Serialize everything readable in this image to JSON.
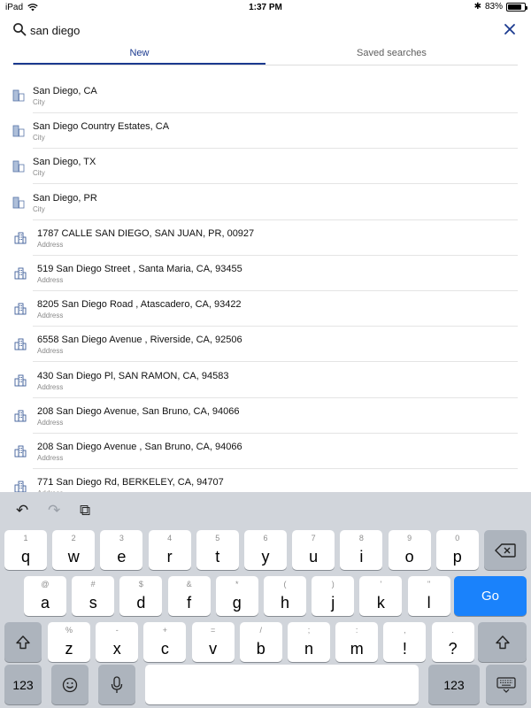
{
  "status_bar": {
    "device": "iPad",
    "time": "1:37 PM",
    "battery": "83%",
    "battery_level": 0.83,
    "bluetooth_glyph": "✱"
  },
  "search": {
    "query": "san diego",
    "icon": "search-icon",
    "close_icon": "close-icon"
  },
  "tabs": [
    {
      "label": "New",
      "active": true
    },
    {
      "label": "Saved searches",
      "active": false
    }
  ],
  "colors": {
    "accent": "#1b3a8f",
    "go_key": "#1a82fb",
    "keyboard_bg": "#d1d5db"
  },
  "results": [
    {
      "title": "San Diego, CA",
      "type": "City",
      "icon": "city-icon"
    },
    {
      "title": "San Diego Country Estates, CA",
      "type": "City",
      "icon": "city-icon"
    },
    {
      "title": "San Diego, TX",
      "type": "City",
      "icon": "city-icon"
    },
    {
      "title": "San Diego, PR",
      "type": "City",
      "icon": "city-icon"
    },
    {
      "title": "1787 CALLE SAN DIEGO, SAN JUAN, PR, 00927",
      "type": "Address",
      "icon": "building-icon"
    },
    {
      "title": "519 San Diego Street , Santa Maria, CA, 93455",
      "type": "Address",
      "icon": "building-icon"
    },
    {
      "title": "8205 San Diego Road , Atascadero, CA, 93422",
      "type": "Address",
      "icon": "building-icon"
    },
    {
      "title": "6558 San Diego Avenue , Riverside, CA, 92506",
      "type": "Address",
      "icon": "building-icon"
    },
    {
      "title": "430 San Diego Pl, SAN RAMON, CA, 94583",
      "type": "Address",
      "icon": "building-icon"
    },
    {
      "title": "208 San Diego Avenue, San Bruno, CA, 94066",
      "type": "Address",
      "icon": "building-icon"
    },
    {
      "title": "208 San Diego Avenue , San Bruno, CA, 94066",
      "type": "Address",
      "icon": "building-icon"
    },
    {
      "title": "771 San Diego Rd, BERKELEY, CA, 94707",
      "type": "Address",
      "icon": "building-icon"
    }
  ],
  "keyboard": {
    "toolbar": [
      {
        "name": "undo-icon",
        "glyph": "↶"
      },
      {
        "name": "redo-icon",
        "glyph": "↷"
      },
      {
        "name": "paste-icon",
        "glyph": "⧉"
      }
    ],
    "row1": [
      {
        "main": "q",
        "sub": "1"
      },
      {
        "main": "w",
        "sub": "2"
      },
      {
        "main": "e",
        "sub": "3"
      },
      {
        "main": "r",
        "sub": "4"
      },
      {
        "main": "t",
        "sub": "5"
      },
      {
        "main": "y",
        "sub": "6"
      },
      {
        "main": "u",
        "sub": "7"
      },
      {
        "main": "i",
        "sub": "8"
      },
      {
        "main": "o",
        "sub": "9"
      },
      {
        "main": "p",
        "sub": "0"
      }
    ],
    "row2": [
      {
        "main": "a",
        "sub": "@"
      },
      {
        "main": "s",
        "sub": "#"
      },
      {
        "main": "d",
        "sub": "$"
      },
      {
        "main": "f",
        "sub": "&"
      },
      {
        "main": "g",
        "sub": "*"
      },
      {
        "main": "h",
        "sub": "("
      },
      {
        "main": "j",
        "sub": ")"
      },
      {
        "main": "k",
        "sub": "'"
      },
      {
        "main": "l",
        "sub": "\""
      }
    ],
    "row3": [
      {
        "main": "z",
        "sub": "%"
      },
      {
        "main": "x",
        "sub": "-"
      },
      {
        "main": "c",
        "sub": "+"
      },
      {
        "main": "v",
        "sub": "="
      },
      {
        "main": "b",
        "sub": "/"
      },
      {
        "main": "n",
        "sub": ";"
      },
      {
        "main": "m",
        "sub": ":"
      },
      {
        "main": "!",
        "sub": ","
      },
      {
        "main": "?",
        "sub": "."
      }
    ],
    "go_label": "Go",
    "numbers_label": "123",
    "backspace_icon": "backspace-icon",
    "shift_icon": "shift-icon",
    "emoji_icon": "emoji-icon",
    "mic_icon": "microphone-icon",
    "hide_keyboard_icon": "keyboard-hide-icon"
  }
}
